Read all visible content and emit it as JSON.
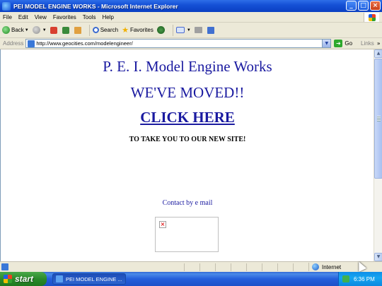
{
  "window": {
    "title": "PEI MODEL ENGINE WORKS - Microsoft Internet Explorer"
  },
  "menu": [
    "File",
    "Edit",
    "View",
    "Favorites",
    "Tools",
    "Help"
  ],
  "toolbar": {
    "back_label": "Back",
    "search_label": "Search",
    "favorites_label": "Favorites"
  },
  "address": {
    "label": "Address",
    "url": "http://www.geocities.com/modelengineer/",
    "go_label": "Go",
    "links_label": "Links"
  },
  "page": {
    "title": "P. E. I. Model Engine Works",
    "moved": "WE'VE MOVED!!",
    "click_here": "CLICK HERE",
    "subtitle": "TO TAKE YOU TO OUR NEW SITE!",
    "contact": "Contact by e mail"
  },
  "status": {
    "zone": "Internet"
  },
  "taskbar": {
    "start_label": "start",
    "task_label": "PEI MODEL ENGINE ...",
    "clock": "6:36 PM"
  }
}
